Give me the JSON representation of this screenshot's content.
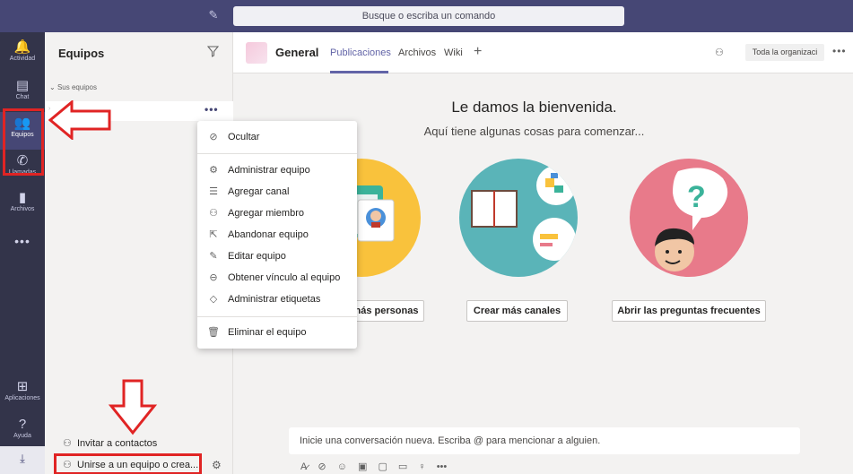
{
  "topbar": {
    "search_placeholder": "Busque o escriba un comando",
    "colors": {
      "topbar_bg": "#464775",
      "rail_bg": "#33344a",
      "accent": "#6264a7",
      "highlight": "#e02424"
    }
  },
  "rail": {
    "items": [
      {
        "label": "Actividad",
        "icon": "bell-icon",
        "glyph": "🔔"
      },
      {
        "label": "Chat",
        "icon": "chat-icon",
        "glyph": "▤"
      },
      {
        "label": "Equipos",
        "icon": "teams-icon",
        "glyph": "👥"
      },
      {
        "label": "Llamadas",
        "icon": "phone-icon",
        "glyph": "✆"
      },
      {
        "label": "Archivos",
        "icon": "file-icon",
        "glyph": "▮"
      }
    ],
    "more": "•••",
    "apps": {
      "label": "Aplicaciones",
      "icon": "apps-icon",
      "glyph": "⊞"
    },
    "help": {
      "label": "Ayuda",
      "icon": "help-icon",
      "glyph": "?"
    },
    "download_glyph": "⤓"
  },
  "panel": {
    "title": "Equipos",
    "section_label": "Sus equipos",
    "team_more": "•••",
    "invite_label": "Invitar a contactos",
    "join_label": "Unirse a un equipo o crea..."
  },
  "header": {
    "channel": "General",
    "tabs": [
      "Publicaciones",
      "Archivos",
      "Wiki"
    ],
    "add_tab": "+",
    "org_button": "Toda la organizaci",
    "more": "•••"
  },
  "welcome": {
    "title": "Le damos la bienvenida.",
    "subtitle": "Aquí tiene algunas cosas para comenzar...",
    "buttons": [
      "nás personas",
      "Crear más canales",
      "Abrir las preguntas frecuentes"
    ]
  },
  "compose": {
    "placeholder": "Inicie una conversación nueva. Escriba @ para mencionar a alguien."
  },
  "menu": {
    "items": [
      {
        "label": "Ocultar",
        "icon": "hide-icon",
        "glyph": "⊘"
      },
      {
        "label": "Administrar equipo",
        "icon": "gear-icon",
        "glyph": "⚙"
      },
      {
        "label": "Agregar canal",
        "icon": "channel-icon",
        "glyph": "☰"
      },
      {
        "label": "Agregar miembro",
        "icon": "add-member-icon",
        "glyph": "⚇"
      },
      {
        "label": "Abandonar equipo",
        "icon": "leave-icon",
        "glyph": "⇱"
      },
      {
        "label": "Editar equipo",
        "icon": "pencil-icon",
        "glyph": "✎"
      },
      {
        "label": "Obtener vínculo al equipo",
        "icon": "link-icon",
        "glyph": "⊖"
      },
      {
        "label": "Administrar etiquetas",
        "icon": "tag-icon",
        "glyph": "◇"
      },
      {
        "label": "Eliminar el equipo",
        "icon": "trash-icon",
        "glyph": "🗑"
      }
    ]
  }
}
